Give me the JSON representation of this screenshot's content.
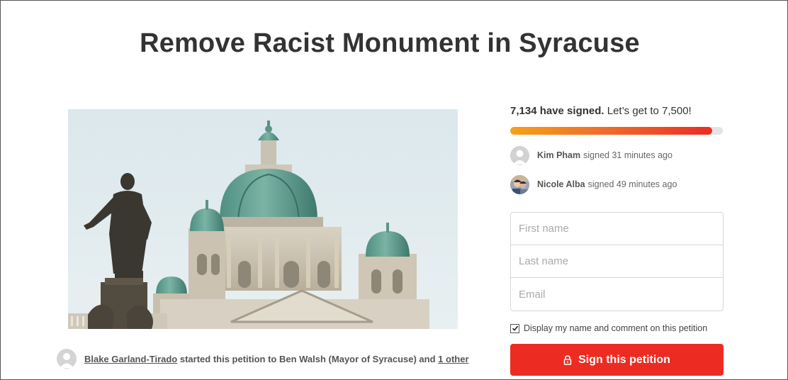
{
  "petition": {
    "title": "Remove Racist Monument in Syracuse"
  },
  "progress": {
    "signed_count": "7,134 have signed.",
    "goal_text": " Let’s get to 7,500!",
    "fraction": 0.951,
    "gradient_colors": [
      "#f8a017",
      "#f0682a",
      "#ec2c24"
    ]
  },
  "recent_signers": [
    {
      "name": "Kim Pham",
      "action": "signed 31 minutes ago",
      "avatar": "default-user-icon"
    },
    {
      "name": "Nicole Alba",
      "action": "signed 49 minutes ago",
      "avatar": "user-photo"
    }
  ],
  "form": {
    "first_name_placeholder": "First name",
    "last_name_placeholder": "Last name",
    "email_placeholder": "Email",
    "display_checkbox_label": "Display my name and comment on this petition",
    "display_checked": true,
    "submit_label": "Sign this petition",
    "submit_icon": "lock-icon"
  },
  "author": {
    "name": "Blake Garland-Tirado",
    "text": " started this petition to Ben Walsh (Mayor of Syracuse) and ",
    "others_link": "1 other"
  },
  "colors": {
    "accent": "#ec2c22",
    "title": "#333333"
  }
}
